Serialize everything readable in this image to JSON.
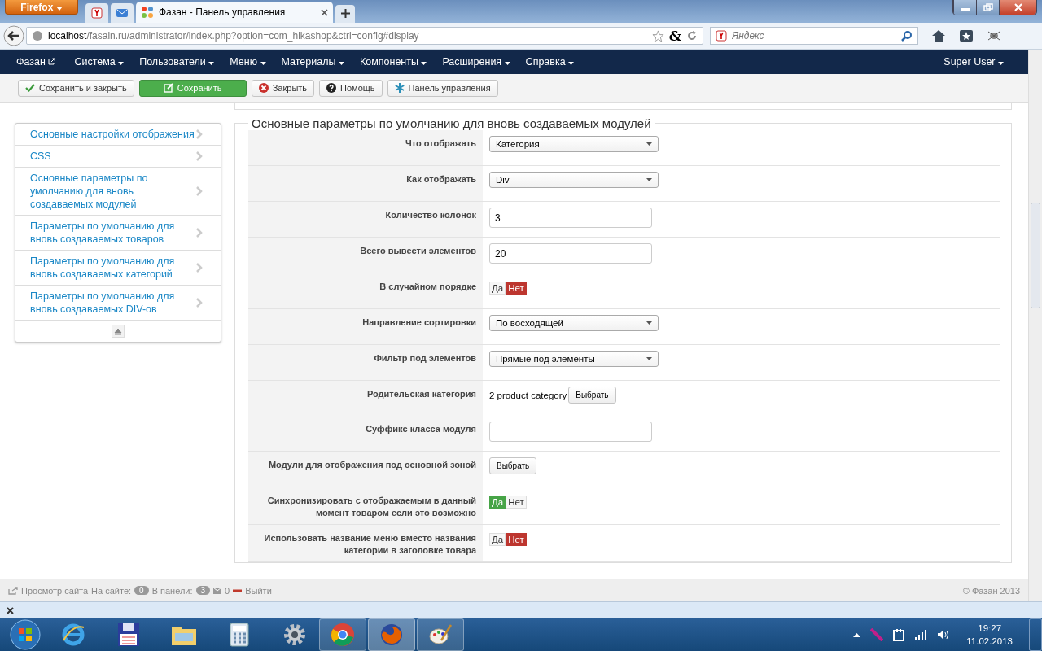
{
  "browser": {
    "app_button": "Firefox",
    "active_tab": {
      "title": "Фазан - Панель управления",
      "selected": true
    },
    "addon_icon": "&",
    "url_host": "localhost",
    "url_path": "/fasain.ru/administrator/index.php?option=com_hikashop&ctrl=config#display",
    "search": {
      "placeholder": "Яндекс"
    }
  },
  "nav": {
    "brand": "Фазан",
    "menus": [
      "Система",
      "Пользователи",
      "Меню",
      "Материалы",
      "Компоненты",
      "Расширения",
      "Справка"
    ],
    "user": "Super User"
  },
  "toolbar": [
    {
      "kind": "save-close",
      "label": "Сохранить и закрыть"
    },
    {
      "kind": "save",
      "label": "Сохранить"
    },
    {
      "kind": "close",
      "label": "Закрыть"
    },
    {
      "kind": "help",
      "label": "Помощь"
    },
    {
      "kind": "dashboard",
      "label": "Панель управления"
    }
  ],
  "sidebar": {
    "items": [
      "Основные настройки отображения",
      "CSS",
      "Основные параметры по умолчанию для вновь создаваемых модулей",
      "Параметры по умолчанию для вновь создаваемых товаров",
      "Параметры по умолчанию для вновь создаваемых категорий",
      "Параметры по умолчанию для вновь создаваемых DIV-ов"
    ]
  },
  "fieldset": {
    "legend": "Основные параметры по умолчанию для вновь создаваемых модулей",
    "rows": [
      {
        "kind": "select",
        "label": "Что отображать",
        "value": "Категория"
      },
      {
        "kind": "select",
        "label": "Как отображать",
        "value": "Div"
      },
      {
        "kind": "input",
        "label": "Количество колонок",
        "value": "3"
      },
      {
        "kind": "input",
        "label": "Всего вывести элементов",
        "value": "20"
      },
      {
        "kind": "toggle",
        "label": "В случайном порядке",
        "options": [
          {
            "label": "Да",
            "selected": false
          },
          {
            "label": "Нет",
            "selected": true
          }
        ]
      },
      {
        "kind": "select",
        "label": "Направление сортировки",
        "value": "По восходящей"
      },
      {
        "kind": "select",
        "label": "Фильтр под элементов",
        "value": "Прямые под элементы"
      },
      {
        "kind": "picker",
        "label": "Родительская категория",
        "value": "2 product category",
        "button": "Выбрать"
      },
      {
        "kind": "input",
        "label": "Суффикс класса модуля"
      },
      {
        "kind": "button",
        "label": "Модули для отображения под основной зоной",
        "button": "Выбрать"
      },
      {
        "kind": "toggle",
        "label": "Синхронизировать с отображаемым в данный момент товаром если это возможно",
        "options": [
          {
            "label": "Да",
            "selected": true
          },
          {
            "label": "Нет",
            "selected": false
          }
        ]
      },
      {
        "kind": "toggle",
        "label": "Использовать название меню вместо названия категории в заголовке товара",
        "options": [
          {
            "label": "Да",
            "selected": false
          },
          {
            "label": "Нет",
            "selected": true
          }
        ]
      }
    ]
  },
  "footer": {
    "view_site": "Просмотр сайта",
    "on_site_label": "На сайте:",
    "on_site_count": "0",
    "admin_label": "В панели:",
    "admin_count": "3",
    "messages": "0",
    "logout": "Выйти",
    "copyright": "© Фазан 2013"
  },
  "taskbar": {
    "time": "19:27",
    "date": "11.02.2013"
  }
}
